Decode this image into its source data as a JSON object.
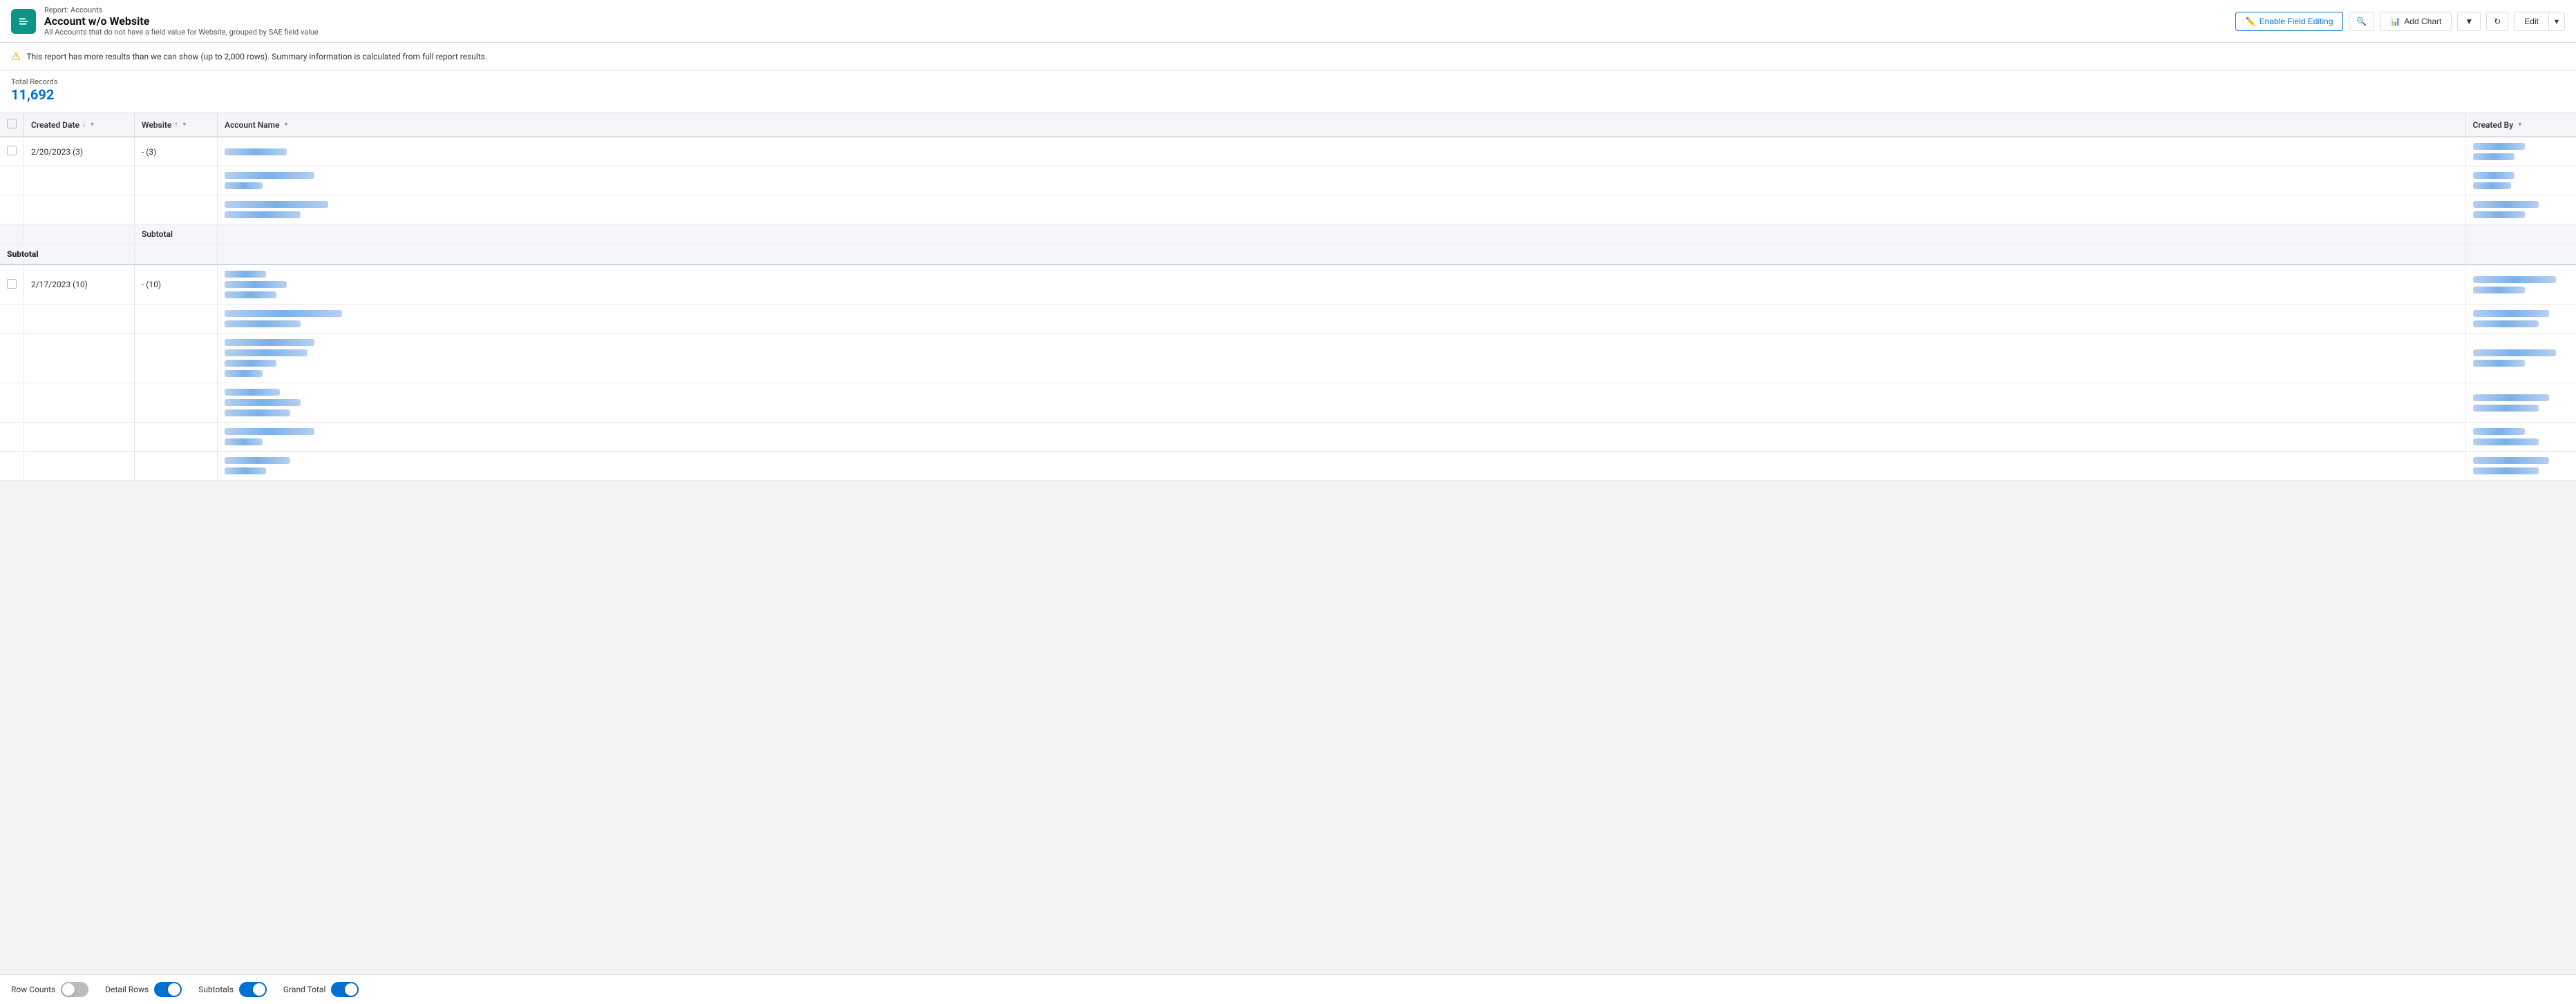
{
  "header": {
    "logo_alt": "Salesforce Reports icon",
    "report_label": "Report: Accounts",
    "title": "Account w/o Website",
    "description": "All Accounts that do not have a field value for Website, grouped by SAE field value"
  },
  "toolbar": {
    "enable_field_editing_label": "Enable Field Editing",
    "add_chart_label": "Add Chart",
    "edit_label": "Edit"
  },
  "warning": {
    "text": "This report has more results than we can show (up to 2,000 rows). Summary information is calculated from full report results."
  },
  "stats": {
    "label": "Total Records",
    "value": "11,692"
  },
  "columns": [
    {
      "key": "checkbox",
      "label": ""
    },
    {
      "key": "created_date",
      "label": "Created Date",
      "sort": "desc",
      "filter": true
    },
    {
      "key": "website",
      "label": "Website",
      "sort": "asc",
      "filter": true
    },
    {
      "key": "account_name",
      "label": "Account Name",
      "filter": true
    },
    {
      "key": "created_by",
      "label": "Created By",
      "filter": true
    }
  ],
  "rows": [
    {
      "group_date": "2/20/2023 (3)",
      "group_website": "- (3)",
      "accounts": [
        {
          "name_blur": [
            90,
            10
          ],
          "created_blur": [
            75,
            10
          ]
        },
        {
          "name_blur": [
            130,
            10
          ],
          "created_blur": [
            60,
            10
          ]
        },
        {
          "name_blur": [
            150,
            10
          ],
          "created_blur": [
            80,
            10
          ]
        }
      ],
      "subtotal_label": "Subtotal"
    },
    {
      "group_date": "2/17/2023 (10)",
      "group_website": "- (10)",
      "accounts": [
        {
          "name_blur": [
            100,
            10
          ],
          "created_blur": [
            90,
            10
          ]
        },
        {
          "name_blur": [
            140,
            10
          ],
          "created_blur": [
            70,
            10
          ]
        },
        {
          "name_blur": [
            160,
            10
          ],
          "created_blur": [
            95,
            10
          ]
        },
        {
          "name_blur": [
            120,
            10
          ],
          "created_blur": [
            70,
            10
          ]
        },
        {
          "name_blur": [
            110,
            10
          ],
          "created_blur": [
            65,
            10
          ]
        },
        {
          "name_blur": [
            85,
            10
          ],
          "created_blur": [
            75,
            10
          ]
        }
      ]
    }
  ],
  "footer": {
    "row_counts_label": "Row Counts",
    "row_counts_on": false,
    "detail_rows_label": "Detail Rows",
    "detail_rows_on": true,
    "subtotals_label": "Subtotals",
    "subtotals_on": true,
    "grand_total_label": "Grand Total",
    "grand_total_on": true
  }
}
